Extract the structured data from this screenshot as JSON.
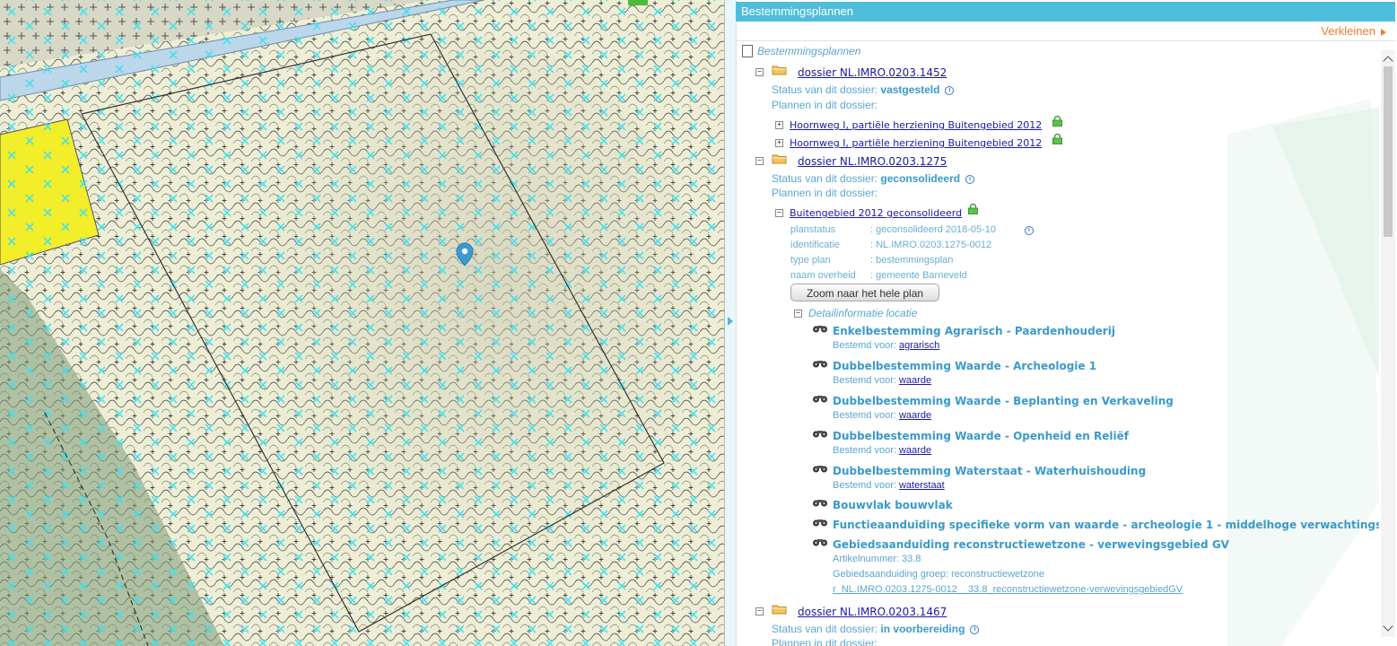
{
  "panel": {
    "title": "Bestemmingsplannen",
    "shrink_label": "Verkleinen",
    "root_label": "Bestemmingsplannen"
  },
  "dossiers": [
    {
      "name": "dossier NL.IMRO.0203.1452",
      "status_label": "Status van dit dossier:",
      "status": "vastgesteld",
      "plans_label": "Plannen in dit dossier:",
      "plans": [
        "Hoornweg I, partiële herziening Buitengebied 2012",
        "Hoornweg I, partiële herziening Buitengebied 2012"
      ]
    },
    {
      "name": "dossier NL.IMRO.0203.1275",
      "status_label": "Status van dit dossier:",
      "status": "geconsolideerd",
      "plans_label": "Plannen in dit dossier:",
      "plan": {
        "name": "Buitengebied 2012 geconsolideerd",
        "attributes": [
          {
            "label": "planstatus",
            "value": ": geconsolideerd 2018-05-10"
          },
          {
            "label": "identificatie",
            "value": ": NL.IMRO.0203.1275-0012"
          },
          {
            "label": "type plan",
            "value": ": bestemmingsplan"
          },
          {
            "label": "naam overheid",
            "value": ": gemeente Barneveld"
          }
        ],
        "zoom_button": "Zoom naar het hele plan",
        "detail_label": "Detailinformatie locatie",
        "details": [
          {
            "title": "Enkelbestemming Agrarisch - Paardenhouderij",
            "sub_label": "Bestemd voor:",
            "sub_link": "agrarisch"
          },
          {
            "title": "Dubbelbestemming Waarde - Archeologie 1",
            "sub_label": "Bestemd voor:",
            "sub_link": "waarde"
          },
          {
            "title": "Dubbelbestemming Waarde - Beplanting en Verkaveling",
            "sub_label": "Bestemd voor:",
            "sub_link": "waarde"
          },
          {
            "title": "Dubbelbestemming Waarde - Openheid en Reliëf",
            "sub_label": "Bestemd voor:",
            "sub_link": "waarde"
          },
          {
            "title": "Dubbelbestemming Waterstaat - Waterhuishouding",
            "sub_label": "Bestemd voor:",
            "sub_link": "waterstaat"
          },
          {
            "title": "Bouwvlak bouwvlak"
          },
          {
            "title": "Functieaanduiding specifieke vorm van waarde - archeologie 1 - middelhoge verwachtingswaarde"
          },
          {
            "title": "Gebiedsaanduiding reconstructiewetzone - verwevingsgebied GV",
            "lines": [
              "Artikelnummer: 33.8",
              "Gebiedsaanduiding groep: reconstructiewetzone"
            ],
            "link": "r_NL.IMRO.0203.1275-0012__33.8_reconstructiewetzone-verwevingsgebiedGV"
          }
        ]
      }
    },
    {
      "name": "dossier NL.IMRO.0203.1467",
      "status_label": "Status van dit dossier:",
      "status": "in voorbereiding",
      "plans_label": "Plannen in dit dossier:"
    }
  ],
  "colors": {
    "header": "#4fbedc",
    "accent_orange": "#ee7a2e",
    "map_base": "#eeeed6",
    "map_yellow": "#f2ee2a",
    "map_green": "#7d9a78",
    "marker": "#3b9bd0"
  }
}
